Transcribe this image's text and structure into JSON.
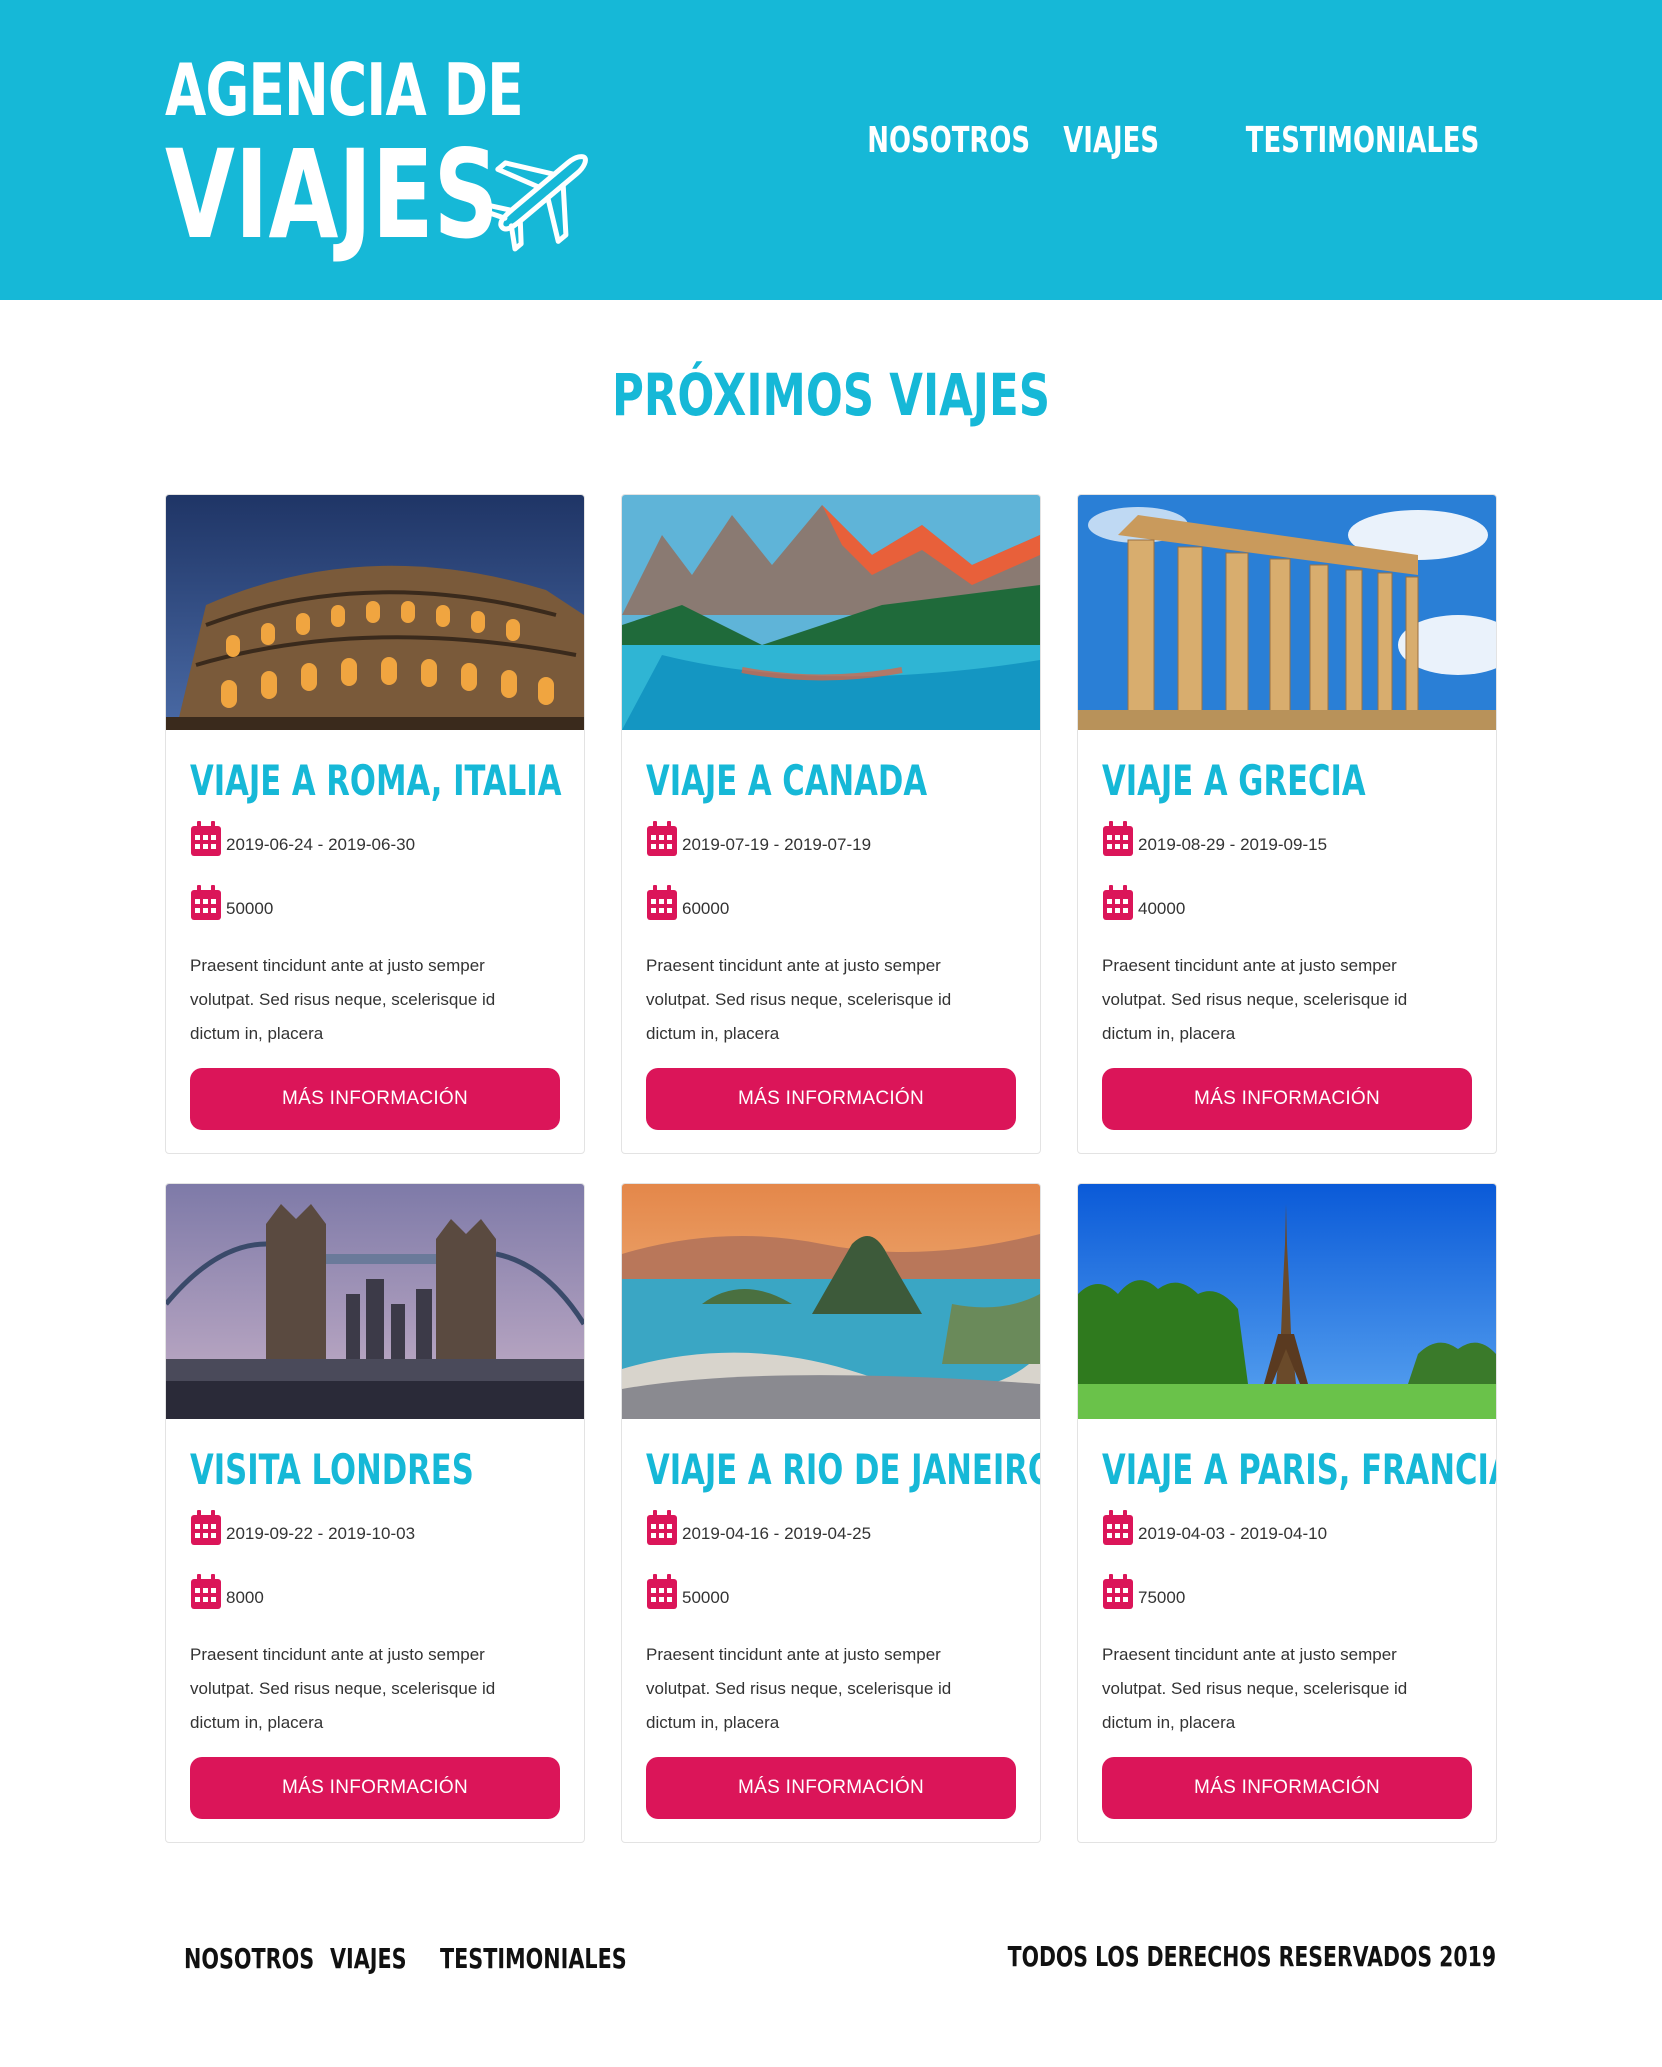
{
  "brand": {
    "line1": "AGENCIA DE",
    "line2": "VIAJES",
    "logo_icon": "airplane-icon"
  },
  "nav": {
    "items": [
      {
        "label": "NOSOTROS"
      },
      {
        "label": "VIAJES"
      },
      {
        "label": "TESTIMONIALES"
      }
    ]
  },
  "main": {
    "title": "PRÓXIMOS VIAJES"
  },
  "trips": [
    {
      "title": "VIAJE A ROMA, ITALIA",
      "dates": "2019-06-24 - 2019-06-30",
      "price": "50000",
      "description": "Praesent tincidunt ante at justo semper volutpat. Sed risus neque, scelerisque id dictum in, placera",
      "button": "MÁS INFORMACIÓN",
      "image": "rome-colosseum"
    },
    {
      "title": "VIAJE A CANADA",
      "dates": "2019-07-19 - 2019-07-19",
      "price": "60000",
      "description": "Praesent tincidunt ante at justo semper volutpat. Sed risus neque, scelerisque id dictum in, placera",
      "button": "MÁS INFORMACIÓN",
      "image": "canada-lake"
    },
    {
      "title": "VIAJE A GRECIA",
      "dates": "2019-08-29 - 2019-09-15",
      "price": "40000",
      "description": "Praesent tincidunt ante at justo semper volutpat. Sed risus neque, scelerisque id dictum in, placera",
      "button": "MÁS INFORMACIÓN",
      "image": "greece-parthenon"
    },
    {
      "title": "VISITA LONDRES",
      "dates": "2019-09-22 - 2019-10-03",
      "price": "8000",
      "description": "Praesent tincidunt ante at justo semper volutpat. Sed risus neque, scelerisque id dictum in, placera",
      "button": "MÁS INFORMACIÓN",
      "image": "london-tower-bridge"
    },
    {
      "title": "VIAJE A RIO DE JANEIRO",
      "dates": "2019-04-16 - 2019-04-25",
      "price": "50000",
      "description": "Praesent tincidunt ante at justo semper volutpat. Sed risus neque, scelerisque id dictum in, placera",
      "button": "MÁS INFORMACIÓN",
      "image": "rio-sugarloaf"
    },
    {
      "title": "VIAJE A PARIS, FRANCIA",
      "dates": "2019-04-03 - 2019-04-10",
      "price": "75000",
      "description": "Praesent tincidunt ante at justo semper volutpat. Sed risus neque, scelerisque id dictum in, placera",
      "button": "MÁS INFORMACIÓN",
      "image": "paris-eiffel-tower"
    }
  ],
  "icons": {
    "date_icon": "calendar-icon",
    "price_icon": "calendar-icon"
  },
  "colors": {
    "brand_cyan": "#16b8d7",
    "button_pink": "#db1559"
  },
  "footer": {
    "nav": [
      {
        "label": "NOSOTROS"
      },
      {
        "label": "VIAJES"
      },
      {
        "label": "TESTIMONIALES"
      }
    ],
    "copyright": "TODOS LOS DERECHOS RESERVADOS 2019"
  }
}
